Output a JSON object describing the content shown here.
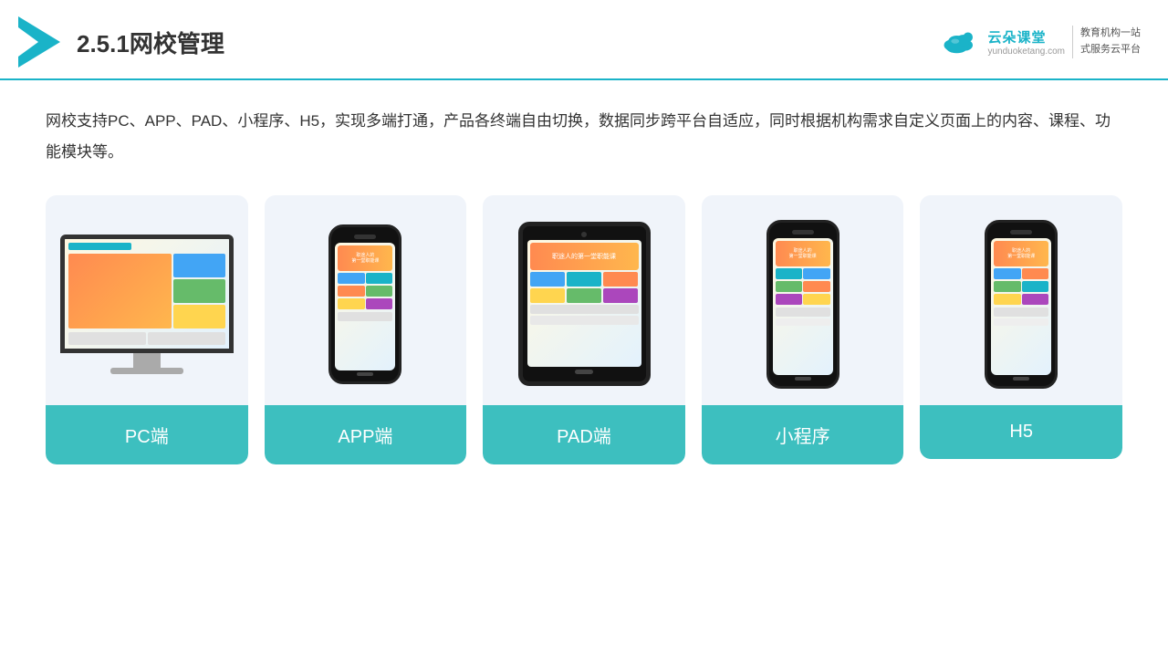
{
  "header": {
    "title": "2.5.1网校管理",
    "brand": {
      "name": "云朵课堂",
      "url": "yunduoketang.com",
      "slogan": "教育机构一站\n式服务云平台"
    }
  },
  "description": "网校支持PC、APP、PAD、小程序、H5，实现多端打通，产品各终端自由切换，数据同步跨平台自适应，同时根据机构需求自定义页面上的内容、课程、功能模块等。",
  "cards": [
    {
      "label": "PC端",
      "type": "pc"
    },
    {
      "label": "APP端",
      "type": "phone"
    },
    {
      "label": "PAD端",
      "type": "tablet"
    },
    {
      "label": "小程序",
      "type": "phone"
    },
    {
      "label": "H5",
      "type": "phone"
    }
  ],
  "colors": {
    "accent": "#1ab3c8",
    "card_bg": "#f0f4fa",
    "label_bg": "#3dbfbf"
  }
}
